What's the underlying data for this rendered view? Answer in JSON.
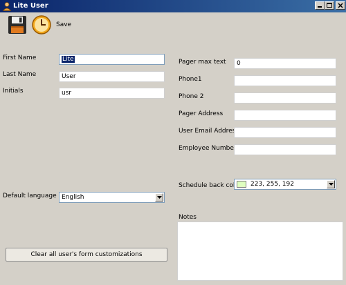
{
  "window": {
    "title": "Lite User",
    "controls": {
      "minimize": "minimize",
      "maximize": "maximize",
      "close": "close"
    }
  },
  "toolbar": {
    "save_label": "Save",
    "icons": [
      "floppy-disk-icon",
      "clock-icon"
    ]
  },
  "form": {
    "first_name": {
      "label": "First Name",
      "value": "Lite"
    },
    "last_name": {
      "label": "Last Name",
      "value": "User"
    },
    "initials": {
      "label": "Initials",
      "value": "usr"
    },
    "default_language": {
      "label": "Default language",
      "value": "English"
    },
    "pager_max_text": {
      "label": "Pager max text",
      "value": "0"
    },
    "phone1": {
      "label": "Phone1",
      "value": ""
    },
    "phone2": {
      "label": "Phone 2",
      "value": ""
    },
    "pager_address": {
      "label": "Pager Address",
      "value": ""
    },
    "user_email": {
      "label": "User Email Address",
      "value": ""
    },
    "employee_number": {
      "label": "Employee Number",
      "value": ""
    },
    "schedule_back_color": {
      "label": "Schedule back colo",
      "value": "223, 255, 192",
      "swatch": "#dfffc0"
    },
    "notes": {
      "label": "Notes",
      "value": ""
    }
  },
  "actions": {
    "clear_customizations": "Clear all user's  form customizations"
  },
  "colors": {
    "titlebar_start": "#0a246a",
    "titlebar_end": "#3a6ea5",
    "window_bg": "#d4d0c8",
    "selection": "#0a246a"
  }
}
